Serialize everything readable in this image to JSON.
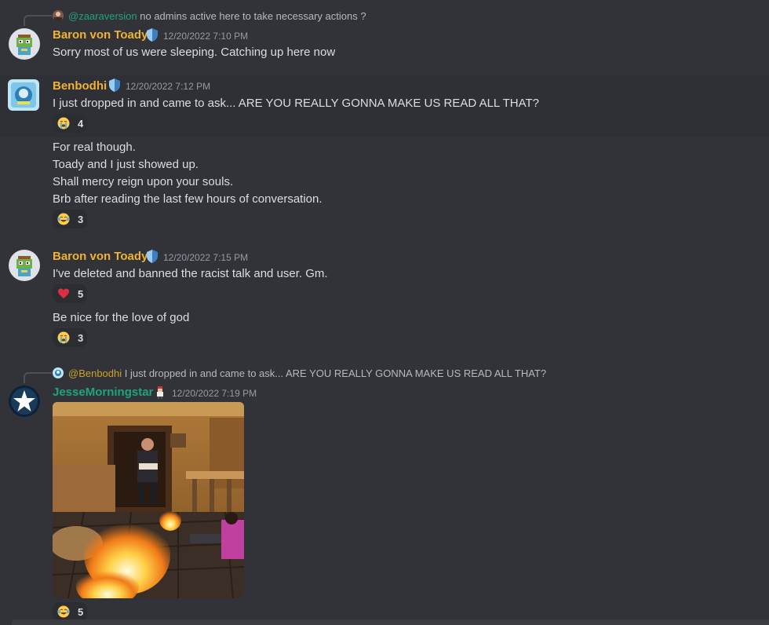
{
  "colors": {
    "background": "#313338",
    "name_gold": "#f0b232",
    "name_green": "#1fa37f",
    "mention_green": "#1fa37f",
    "text": "#dbdee1",
    "timestamp": "#949ba4"
  },
  "messages": [
    {
      "reply": {
        "mention": "@zaaraversion",
        "text": "no admins active here to take necessary actions ?"
      },
      "author": "Baron von Toady",
      "badge_icon": "shield-icon",
      "timestamp": "12/20/2022 7:10 PM",
      "lines": [
        "Sorry most of us were sleeping. Catching up here now"
      ]
    },
    {
      "author": "Benbodhi",
      "badge_icon": "shield-icon",
      "timestamp": "12/20/2022 7:12 PM",
      "lines": [
        "I just dropped in and came to ask... ARE YOU REALLY GONNA MAKE US READ ALL THAT?"
      ],
      "reaction": {
        "emoji": "sob-emoji",
        "count": "4"
      },
      "followups": [
        {
          "lines": [
            "For real though.",
            "Toady and I just showed up.",
            "Shall mercy reign upon your souls.",
            "Brb after reading the last few hours of conversation."
          ],
          "reaction": {
            "emoji": "joy-emoji",
            "count": "3"
          }
        }
      ]
    },
    {
      "author": "Baron von Toady",
      "badge_icon": "shield-icon",
      "timestamp": "12/20/2022 7:15 PM",
      "lines": [
        "I've deleted and banned the racist talk and user. Gm."
      ],
      "reaction": {
        "emoji": "heart-emoji",
        "count": "5"
      },
      "followups": [
        {
          "lines": [
            "Be nice for the love of god"
          ],
          "reaction": {
            "emoji": "sob-emoji",
            "count": "3"
          }
        }
      ]
    },
    {
      "reply": {
        "mention": "@Benbodhi",
        "text": "I just dropped in and came to ask... ARE YOU REALLY GONNA MAKE US READ ALL THAT?"
      },
      "author": "JesseMorningstar",
      "badge_icon": "pixel-character-icon",
      "timestamp": "12/20/2022 7:19 PM",
      "attachment": "gif-burning-room",
      "reaction": {
        "emoji": "joy-emoji",
        "count": "5"
      }
    }
  ]
}
